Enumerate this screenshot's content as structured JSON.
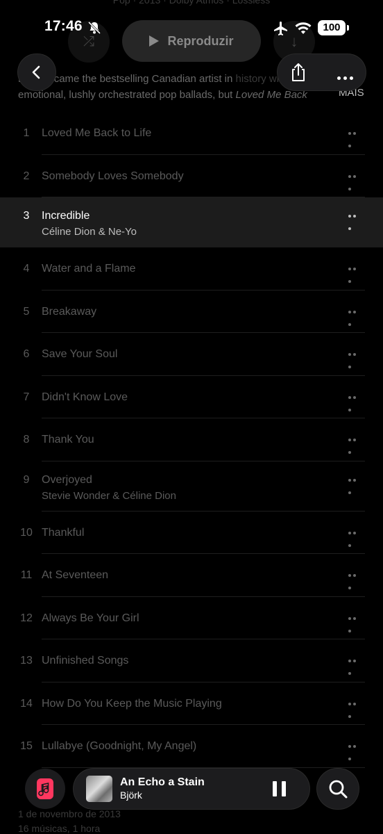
{
  "header": {
    "meta_line": "Pop · 2013 · Dolby Atmos · Lossless",
    "play_label": "Reproduzir"
  },
  "status_bar": {
    "time": "17:46",
    "battery": "100"
  },
  "description": {
    "line1": "Dion became the bestselling Canadian artist in",
    "line1_faded": "history with",
    "line2_prefix": "emotional, lushly orchestrated pop ballads, but",
    "line2_italic": "Loved Me Back",
    "more_label": "MAIS"
  },
  "tracks": [
    {
      "number": "1",
      "title": "Loved Me Back to Life",
      "artist": ""
    },
    {
      "number": "2",
      "title": "Somebody Loves Somebody",
      "artist": ""
    },
    {
      "number": "3",
      "title": "Incredible",
      "artist": "Céline Dion & Ne-Yo"
    },
    {
      "number": "4",
      "title": "Water and a Flame",
      "artist": ""
    },
    {
      "number": "5",
      "title": "Breakaway",
      "artist": ""
    },
    {
      "number": "6",
      "title": "Save Your Soul",
      "artist": ""
    },
    {
      "number": "7",
      "title": "Didn't Know Love",
      "artist": ""
    },
    {
      "number": "8",
      "title": "Thank You",
      "artist": ""
    },
    {
      "number": "9",
      "title": "Overjoyed",
      "artist": "Stevie Wonder & Céline Dion"
    },
    {
      "number": "10",
      "title": "Thankful",
      "artist": ""
    },
    {
      "number": "11",
      "title": "At Seventeen",
      "artist": ""
    },
    {
      "number": "12",
      "title": "Always Be Your Girl",
      "artist": ""
    },
    {
      "number": "13",
      "title": "Unfinished Songs",
      "artist": ""
    },
    {
      "number": "14",
      "title": "How Do You Keep the Music Playing",
      "artist": ""
    },
    {
      "number": "15",
      "title": "Lullabye (Goodnight, My Angel)",
      "artist": ""
    }
  ],
  "active_track": "3",
  "footer": {
    "release_date": "1 de novembro de 2013",
    "summary": "16 músicas, 1 hora"
  },
  "mini_player": {
    "song": "An Echo a Stain",
    "artist": "Björk"
  },
  "colors": {
    "background": "#000000",
    "accent": "#ff375f",
    "highlight_row": "#1c1c1c"
  }
}
